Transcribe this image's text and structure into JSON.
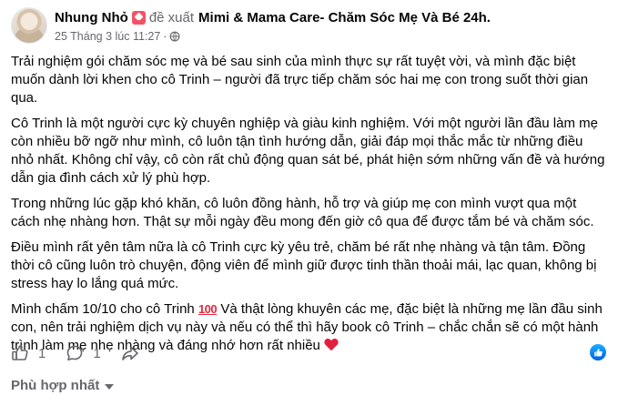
{
  "header": {
    "author": "Nhung Nhỏ",
    "recommends_text": "đề xuất",
    "page_name": "Mimi & Mama Care- Chăm Sóc Mẹ Và Bé 24h.",
    "timestamp": "25 Tháng 3 lúc 11:27",
    "separator": "·",
    "badge_icon": "flag-badge-icon",
    "privacy_icon": "globe-icon"
  },
  "body": {
    "p1": "Trải nghiệm gói chăm sóc mẹ và bé sau sinh của mình thực sự rất tuyệt vời, và mình đặc biệt muốn dành lời khen cho cô Trinh – người đã trực tiếp chăm sóc hai mẹ con trong suốt thời gian qua.",
    "p2": "Cô Trinh là một người cực kỳ chuyên nghiệp và giàu kinh nghiệm. Với một người lần đầu làm mẹ còn nhiều bỡ ngỡ như mình, cô luôn tận tình hướng dẫn, giải đáp mọi thắc mắc từ những điều nhỏ nhất. Không chỉ vậy, cô còn rất chủ động quan sát bé, phát hiện sớm những vấn đề và hướng dẫn gia đình cách xử lý phù hợp.",
    "p3": "Trong những lúc gặp khó khăn, cô luôn đồng hành, hỗ trợ và giúp mẹ con mình vượt qua một cách nhẹ nhàng hơn. Thật sự mỗi ngày đều mong đến giờ cô qua để được tắm bé và chăm sóc.",
    "p4": "Điều mình rất yên tâm nữa là cô Trinh cực kỳ yêu trẻ, chăm bé rất nhẹ nhàng và tận tâm. Đồng thời cô cũng luôn trò chuyện, động viên để mình giữ được tinh thần thoải mái, lạc quan, không bị stress hay lo lắng quá mức.",
    "p5_start": "Mình chấm 10/10 cho cô Trinh ",
    "p5_emoji": "100",
    "p5_end": " Và thật lòng khuyên các mẹ, đặc biệt là những mẹ lần đầu sinh con, nên trải nghiệm dịch vụ này và nếu có thể thì hãy book cô Trinh – chắc chắn sẽ có một hành trình làm mẹ nhẹ nhàng và đáng nhớ hơn rất nhiều ",
    "heart_icon": "red-heart-icon"
  },
  "actions": {
    "like_count": "1",
    "comment_count": "1",
    "like_icon": "thumbs-up-icon",
    "comment_icon": "comment-icon",
    "share_icon": "share-icon",
    "reaction_icon": "like-reaction-icon",
    "accent_color": "#0866ff"
  },
  "sort": {
    "label": "Phù hợp nhất"
  }
}
